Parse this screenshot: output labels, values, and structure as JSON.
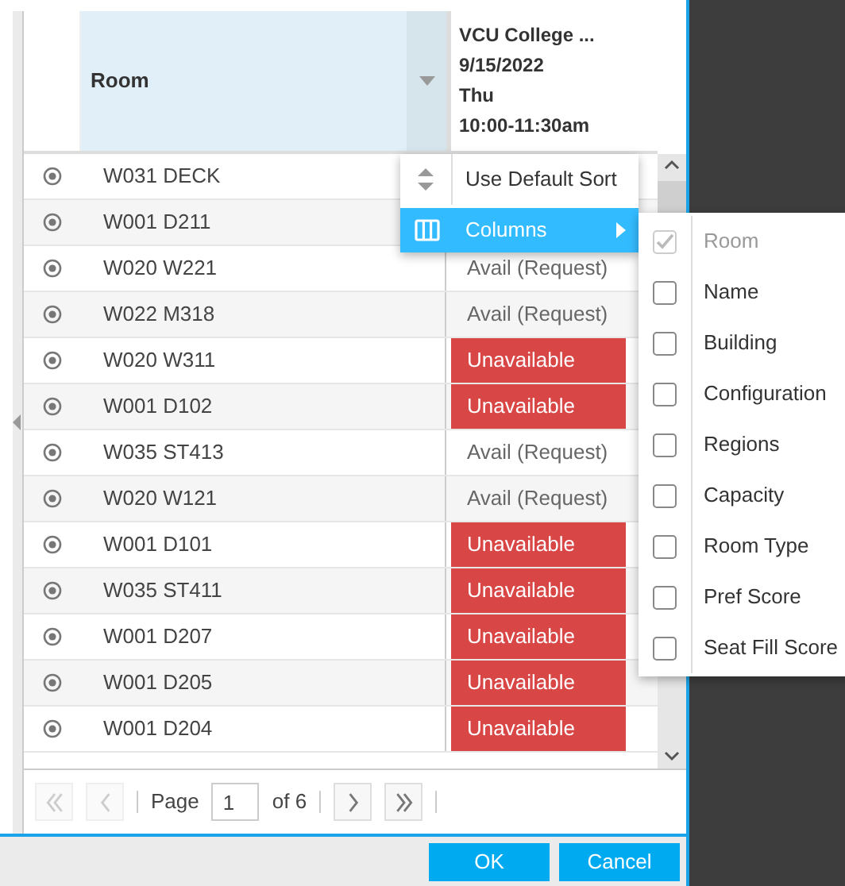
{
  "header": {
    "room_column": "Room",
    "event_column": [
      "VCU College ...",
      "9/15/2022",
      "Thu",
      "10:00-11:30am"
    ]
  },
  "rows": [
    {
      "room": "W031 DECK"
    },
    {
      "room": "W001 D211"
    },
    {
      "room": "W020 W221",
      "status": {
        "kind": "avail",
        "text": "Avail (Request)"
      }
    },
    {
      "room": "W022 M318",
      "status": {
        "kind": "avail",
        "text": "Avail (Request)"
      }
    },
    {
      "room": "W020 W311",
      "status": {
        "kind": "unavailable",
        "text": "Unavailable"
      }
    },
    {
      "room": "W001 D102",
      "status": {
        "kind": "unavailable",
        "text": "Unavailable"
      }
    },
    {
      "room": "W035 ST413",
      "status": {
        "kind": "avail",
        "text": "Avail (Request)"
      }
    },
    {
      "room": "W020 W121",
      "status": {
        "kind": "avail",
        "text": "Avail (Request)"
      }
    },
    {
      "room": "W001 D101",
      "status": {
        "kind": "unavailable",
        "text": "Unavailable"
      }
    },
    {
      "room": "W035 ST411",
      "status": {
        "kind": "unavailable",
        "text": "Unavailable"
      }
    },
    {
      "room": "W001 D207",
      "status": {
        "kind": "unavailable",
        "text": "Unavailable"
      }
    },
    {
      "room": "W001 D205",
      "status": {
        "kind": "unavailable",
        "text": "Unavailable"
      }
    },
    {
      "room": "W001 D204",
      "status": {
        "kind": "unavailable",
        "text": "Unavailable"
      }
    }
  ],
  "column_menu": [
    {
      "kind": "sort",
      "label": "Use Default Sort",
      "selected": false
    },
    {
      "kind": "columns",
      "label": "Columns",
      "selected": true
    }
  ],
  "columns_submenu": [
    {
      "label": "Room",
      "checked": true,
      "disabled": true
    },
    {
      "label": "Name",
      "checked": false,
      "disabled": false
    },
    {
      "label": "Building",
      "checked": false,
      "disabled": false
    },
    {
      "label": "Configuration",
      "checked": false,
      "disabled": false
    },
    {
      "label": "Regions",
      "checked": false,
      "disabled": false
    },
    {
      "label": "Capacity",
      "checked": false,
      "disabled": false
    },
    {
      "label": "Room Type",
      "checked": false,
      "disabled": false
    },
    {
      "label": "Pref Score",
      "checked": false,
      "disabled": false
    },
    {
      "label": "Seat Fill Score",
      "checked": false,
      "disabled": false
    }
  ],
  "pager": {
    "page_label": "Page",
    "page": "1",
    "of": "of 6",
    "buttons": [
      {
        "kind": "first",
        "disabled": true
      },
      {
        "kind": "prev",
        "disabled": true
      },
      {
        "kind": "next",
        "disabled": false
      },
      {
        "kind": "last",
        "disabled": false
      }
    ]
  },
  "buttons": [
    "OK",
    "Cancel"
  ]
}
